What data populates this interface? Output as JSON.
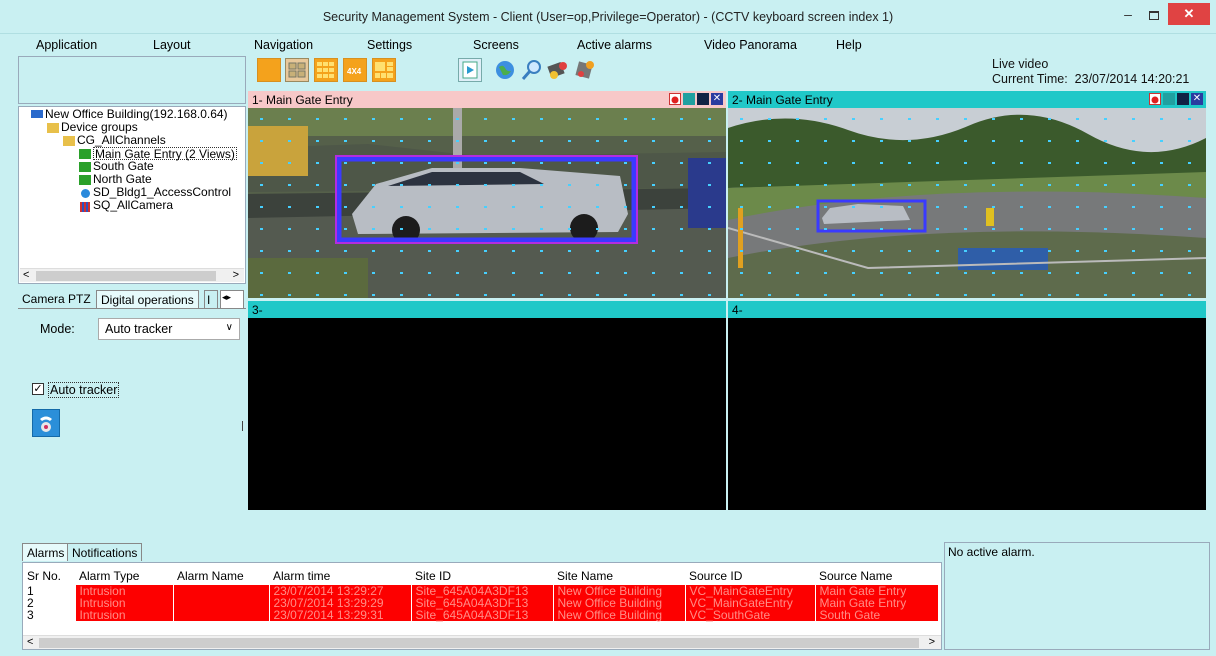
{
  "window": {
    "title": "Security Management System - Client (User=op,Privilege=Operator) - (CCTV keyboard screen index 1)",
    "min": "–",
    "close": "✕"
  },
  "menu": [
    "Application",
    "Layout",
    "Navigation",
    "Settings",
    "Screens",
    "Active alarms",
    "Video Panorama",
    "Help"
  ],
  "status": {
    "mode": "Live video",
    "time_label": "Current Time:",
    "time_value": "23/07/2014 14:20:21"
  },
  "tree": {
    "root": "New Office Building(192.168.0.64)",
    "group": "Device groups",
    "channel_group": "CG_AllChannels",
    "items": [
      "Main Gate Entry (2 Views)",
      "South Gate",
      "North Gate",
      "SD_Bldg1_AccessControl",
      "SQ_AllCamera"
    ]
  },
  "tabs": [
    "Camera PTZ",
    "Digital operations",
    "I"
  ],
  "panel": {
    "mode_label": "Mode:",
    "mode_value": "Auto tracker",
    "checkbox_label": "Auto tracker",
    "checked": true
  },
  "views": [
    {
      "label": "1- Main Gate Entry",
      "header_color": "#f7c8c8"
    },
    {
      "label": "2- Main Gate Entry",
      "header_color": "#20c8c8"
    },
    {
      "label": "3-",
      "header_color": "#20c8c8"
    },
    {
      "label": "4-",
      "header_color": "#20c8c8"
    }
  ],
  "alarm_tabs": [
    "Alarms",
    "Notifications"
  ],
  "alarms": {
    "columns": [
      "Sr No.",
      "Alarm Type",
      "Alarm Name",
      "Alarm time",
      "Site ID",
      "Site Name",
      "Source ID",
      "Source Name"
    ],
    "rows": [
      [
        "1",
        "Intrusion",
        "",
        "23/07/2014 13:29:27",
        "Site_645A04A3DF13",
        "New Office Building",
        "VC_MainGateEntry",
        "Main Gate Entry"
      ],
      [
        "2",
        "Intrusion",
        "",
        "23/07/2014 13:29:29",
        "Site_645A04A3DF13",
        "New Office Building",
        "VC_MainGateEntry",
        "Main Gate Entry"
      ],
      [
        "3",
        "Intrusion",
        "",
        "23/07/2014 13:29:31",
        "Site_645A04A3DF13",
        "New Office Building",
        "VC_SouthGate",
        "South Gate"
      ]
    ]
  },
  "no_alarm_text": "No active alarm.",
  "colors": {
    "background": "#c9f0f2",
    "alarm_row": "#fd0000",
    "alarm_text": "#ff8c86",
    "tracking_box": "#3a3aff"
  }
}
